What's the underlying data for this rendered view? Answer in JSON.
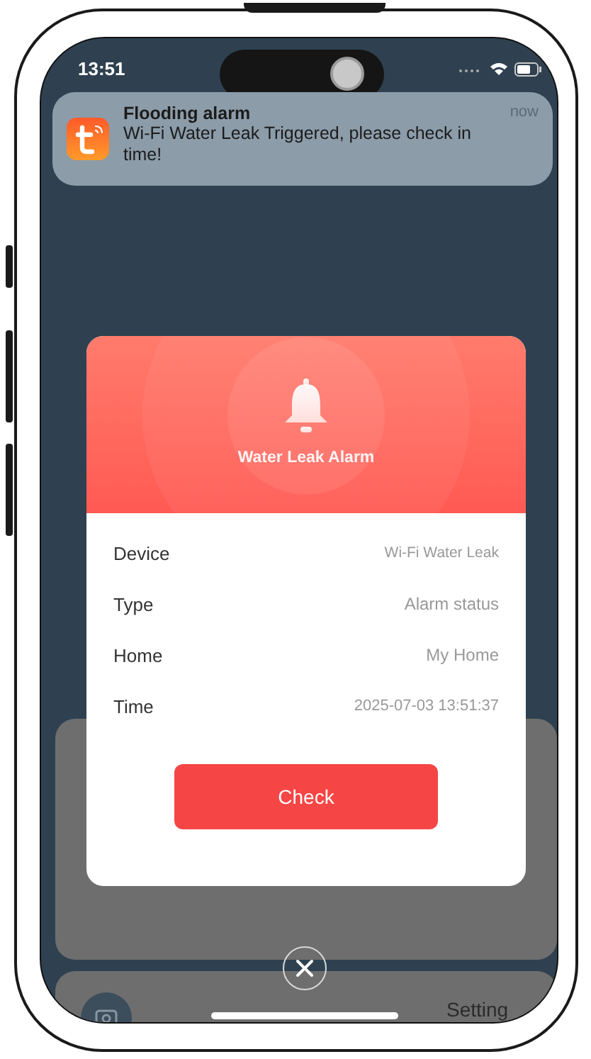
{
  "status_bar": {
    "time": "13:51"
  },
  "notification": {
    "title": "Flooding alarm",
    "message": "Wi-Fi Water Leak Triggered, please check in time!",
    "time": "now"
  },
  "background": {
    "setting_label": "Setting"
  },
  "alert": {
    "title": "Water Leak Alarm",
    "rows": [
      {
        "label": "Device",
        "value": "Wi-Fi Water Leak"
      },
      {
        "label": "Type",
        "value": "Alarm status"
      },
      {
        "label": "Home",
        "value": "My Home"
      },
      {
        "label": "Time",
        "value": "2025-07-03 13:51:37"
      }
    ],
    "button": "Check"
  }
}
